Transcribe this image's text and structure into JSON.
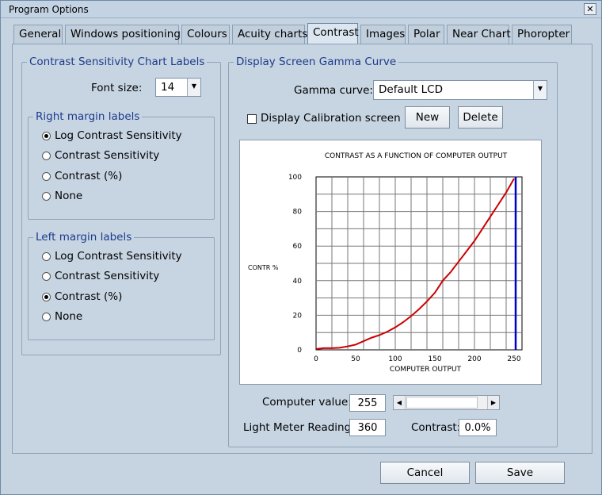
{
  "window": {
    "title": "Program Options",
    "close_glyph": "✕"
  },
  "tabs": [
    {
      "label": "General"
    },
    {
      "label": "Windows positioning"
    },
    {
      "label": "Colours"
    },
    {
      "label": "Acuity charts"
    },
    {
      "label": "Contrast",
      "active": true
    },
    {
      "label": "Images"
    },
    {
      "label": "Polar"
    },
    {
      "label": "Near Chart"
    },
    {
      "label": "Phoropter"
    }
  ],
  "labels_group": {
    "title": "Contrast Sensitivity Chart Labels",
    "font_size_label": "Font size:",
    "font_size_value": "14",
    "right_margin": {
      "title": "Right margin labels",
      "options": [
        "Log Contrast Sensitivity",
        "Contrast Sensitivity",
        "Contrast (%)",
        "None"
      ],
      "selected": 0
    },
    "left_margin": {
      "title": "Left margin labels",
      "options": [
        "Log Contrast Sensitivity",
        "Contrast Sensitivity",
        "Contrast (%)",
        "None"
      ],
      "selected": 2
    }
  },
  "gamma_group": {
    "title": "Display Screen Gamma Curve",
    "gamma_label": "Gamma curve:",
    "gamma_value": "Default LCD",
    "calibration_label": "Display Calibration screen",
    "calibration_checked": false,
    "new_label": "New",
    "delete_label": "Delete",
    "computer_value_label": "Computer value:",
    "computer_value": "255",
    "light_meter_label": "Light Meter Reading:",
    "light_meter_value": "360",
    "contrast_label": "Contrast:",
    "contrast_value": "0.0%"
  },
  "chart_data": {
    "type": "line",
    "title": "CONTRAST AS A FUNCTION OF COMPUTER OUTPUT",
    "xlabel": "COMPUTER OUTPUT",
    "ylabel": "CONTR %",
    "xlim": [
      0,
      260
    ],
    "ylim": [
      0,
      100
    ],
    "xticks": [
      0,
      50,
      100,
      150,
      200,
      250
    ],
    "yticks": [
      0,
      20,
      40,
      60,
      80,
      100
    ],
    "grid": true,
    "series": [
      {
        "color": "#cc0000",
        "x": [
          0,
          10,
          20,
          30,
          40,
          50,
          60,
          70,
          80,
          90,
          100,
          110,
          120,
          130,
          140,
          150,
          160,
          170,
          180,
          190,
          200,
          210,
          220,
          230,
          240,
          250
        ],
        "y": [
          0.5,
          1,
          1,
          1.2,
          2,
          3,
          5,
          7,
          8.5,
          10.5,
          13,
          16,
          19.5,
          23.5,
          28,
          33,
          40,
          45,
          51,
          57,
          63,
          70,
          77,
          84,
          91,
          99
        ]
      }
    ],
    "marker_line": {
      "x": 252,
      "color": "#0000cc"
    }
  },
  "slider": {
    "value": 255,
    "min": 0,
    "max": 255
  },
  "footer": {
    "cancel_label": "Cancel",
    "save_label": "Save"
  }
}
